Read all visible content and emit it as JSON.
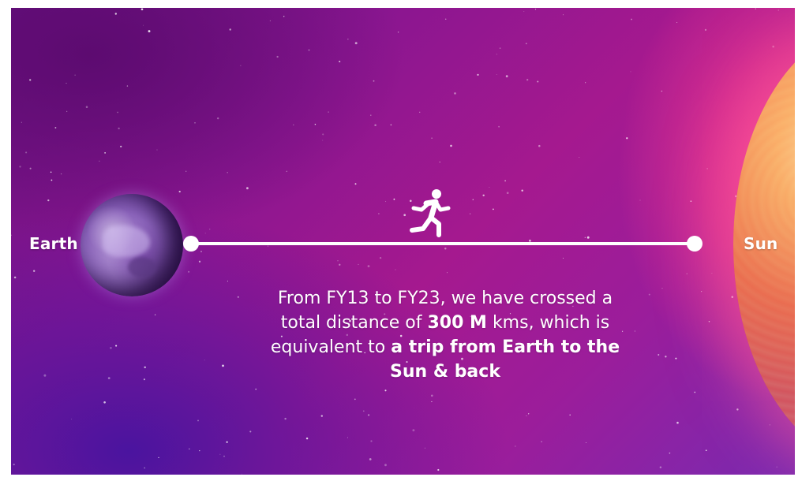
{
  "labels": {
    "earth": "Earth",
    "sun": "Sun"
  },
  "icons": {
    "runner": "running-person-icon"
  },
  "caption": {
    "part1": "From FY13 to FY23, we have crossed a total distance of ",
    "distance": "300 M",
    "part2": " kms, which is equivalent to ",
    "highlight": "a trip from Earth to the Sun & back"
  },
  "colors": {
    "text": "#ffffff",
    "background_primary": "#a5198f",
    "background_deep": "#5a1aa0",
    "sun_glow": "#ff4696"
  }
}
